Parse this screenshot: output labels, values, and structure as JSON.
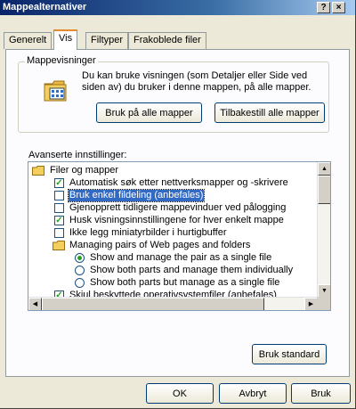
{
  "window": {
    "title": "Mappealternativer",
    "help_label": "?",
    "close_label": "×"
  },
  "tabs": [
    {
      "label": "Generelt",
      "active": false
    },
    {
      "label": "Vis",
      "active": true
    },
    {
      "label": "Filtyper",
      "active": false
    },
    {
      "label": "Frakoblede filer",
      "active": false
    }
  ],
  "folder_views": {
    "legend": "Mappevisninger",
    "description": "Du kan bruke visningen (som Detaljer eller Side ved siden av) du bruker i denne mappen, på alle mapper.",
    "apply_all_button": "Bruk på alle mapper",
    "reset_all_button": "Tilbakestill alle mapper",
    "icon": "folder-options-icon"
  },
  "advanced": {
    "label": "Avanserte innstillinger:",
    "restore_defaults_button": "Bruk standard",
    "items": [
      {
        "type": "folder",
        "label": "Filer og mapper"
      },
      {
        "type": "checkbox",
        "label": "Automatisk søk etter nettverksmapper og -skrivere",
        "checked": true
      },
      {
        "type": "checkbox",
        "label": "Bruk enkel fildeling (anbefales)",
        "checked": false,
        "selected": true
      },
      {
        "type": "checkbox",
        "label": "Gjenopprett tidligere mappevinduer ved pålogging",
        "checked": false
      },
      {
        "type": "checkbox",
        "label": "Husk visningsinnstillingene for hver enkelt mappe",
        "checked": true
      },
      {
        "type": "checkbox",
        "label": "Ikke legg miniatyrbilder i hurtigbuffer",
        "checked": false
      },
      {
        "type": "folder",
        "label": "Managing pairs of Web pages and folders"
      },
      {
        "type": "radio",
        "label": "Show and manage the pair as a single file",
        "checked": true
      },
      {
        "type": "radio",
        "label": "Show both parts and manage them individually",
        "checked": false
      },
      {
        "type": "radio",
        "label": "Show both parts but manage as a single file",
        "checked": false
      },
      {
        "type": "checkbox",
        "label": "Skjul beskyttede operativsystemfiler (anbefales)",
        "checked": true
      }
    ]
  },
  "footer": {
    "ok": "OK",
    "cancel": "Avbryt",
    "apply": "Bruk"
  }
}
